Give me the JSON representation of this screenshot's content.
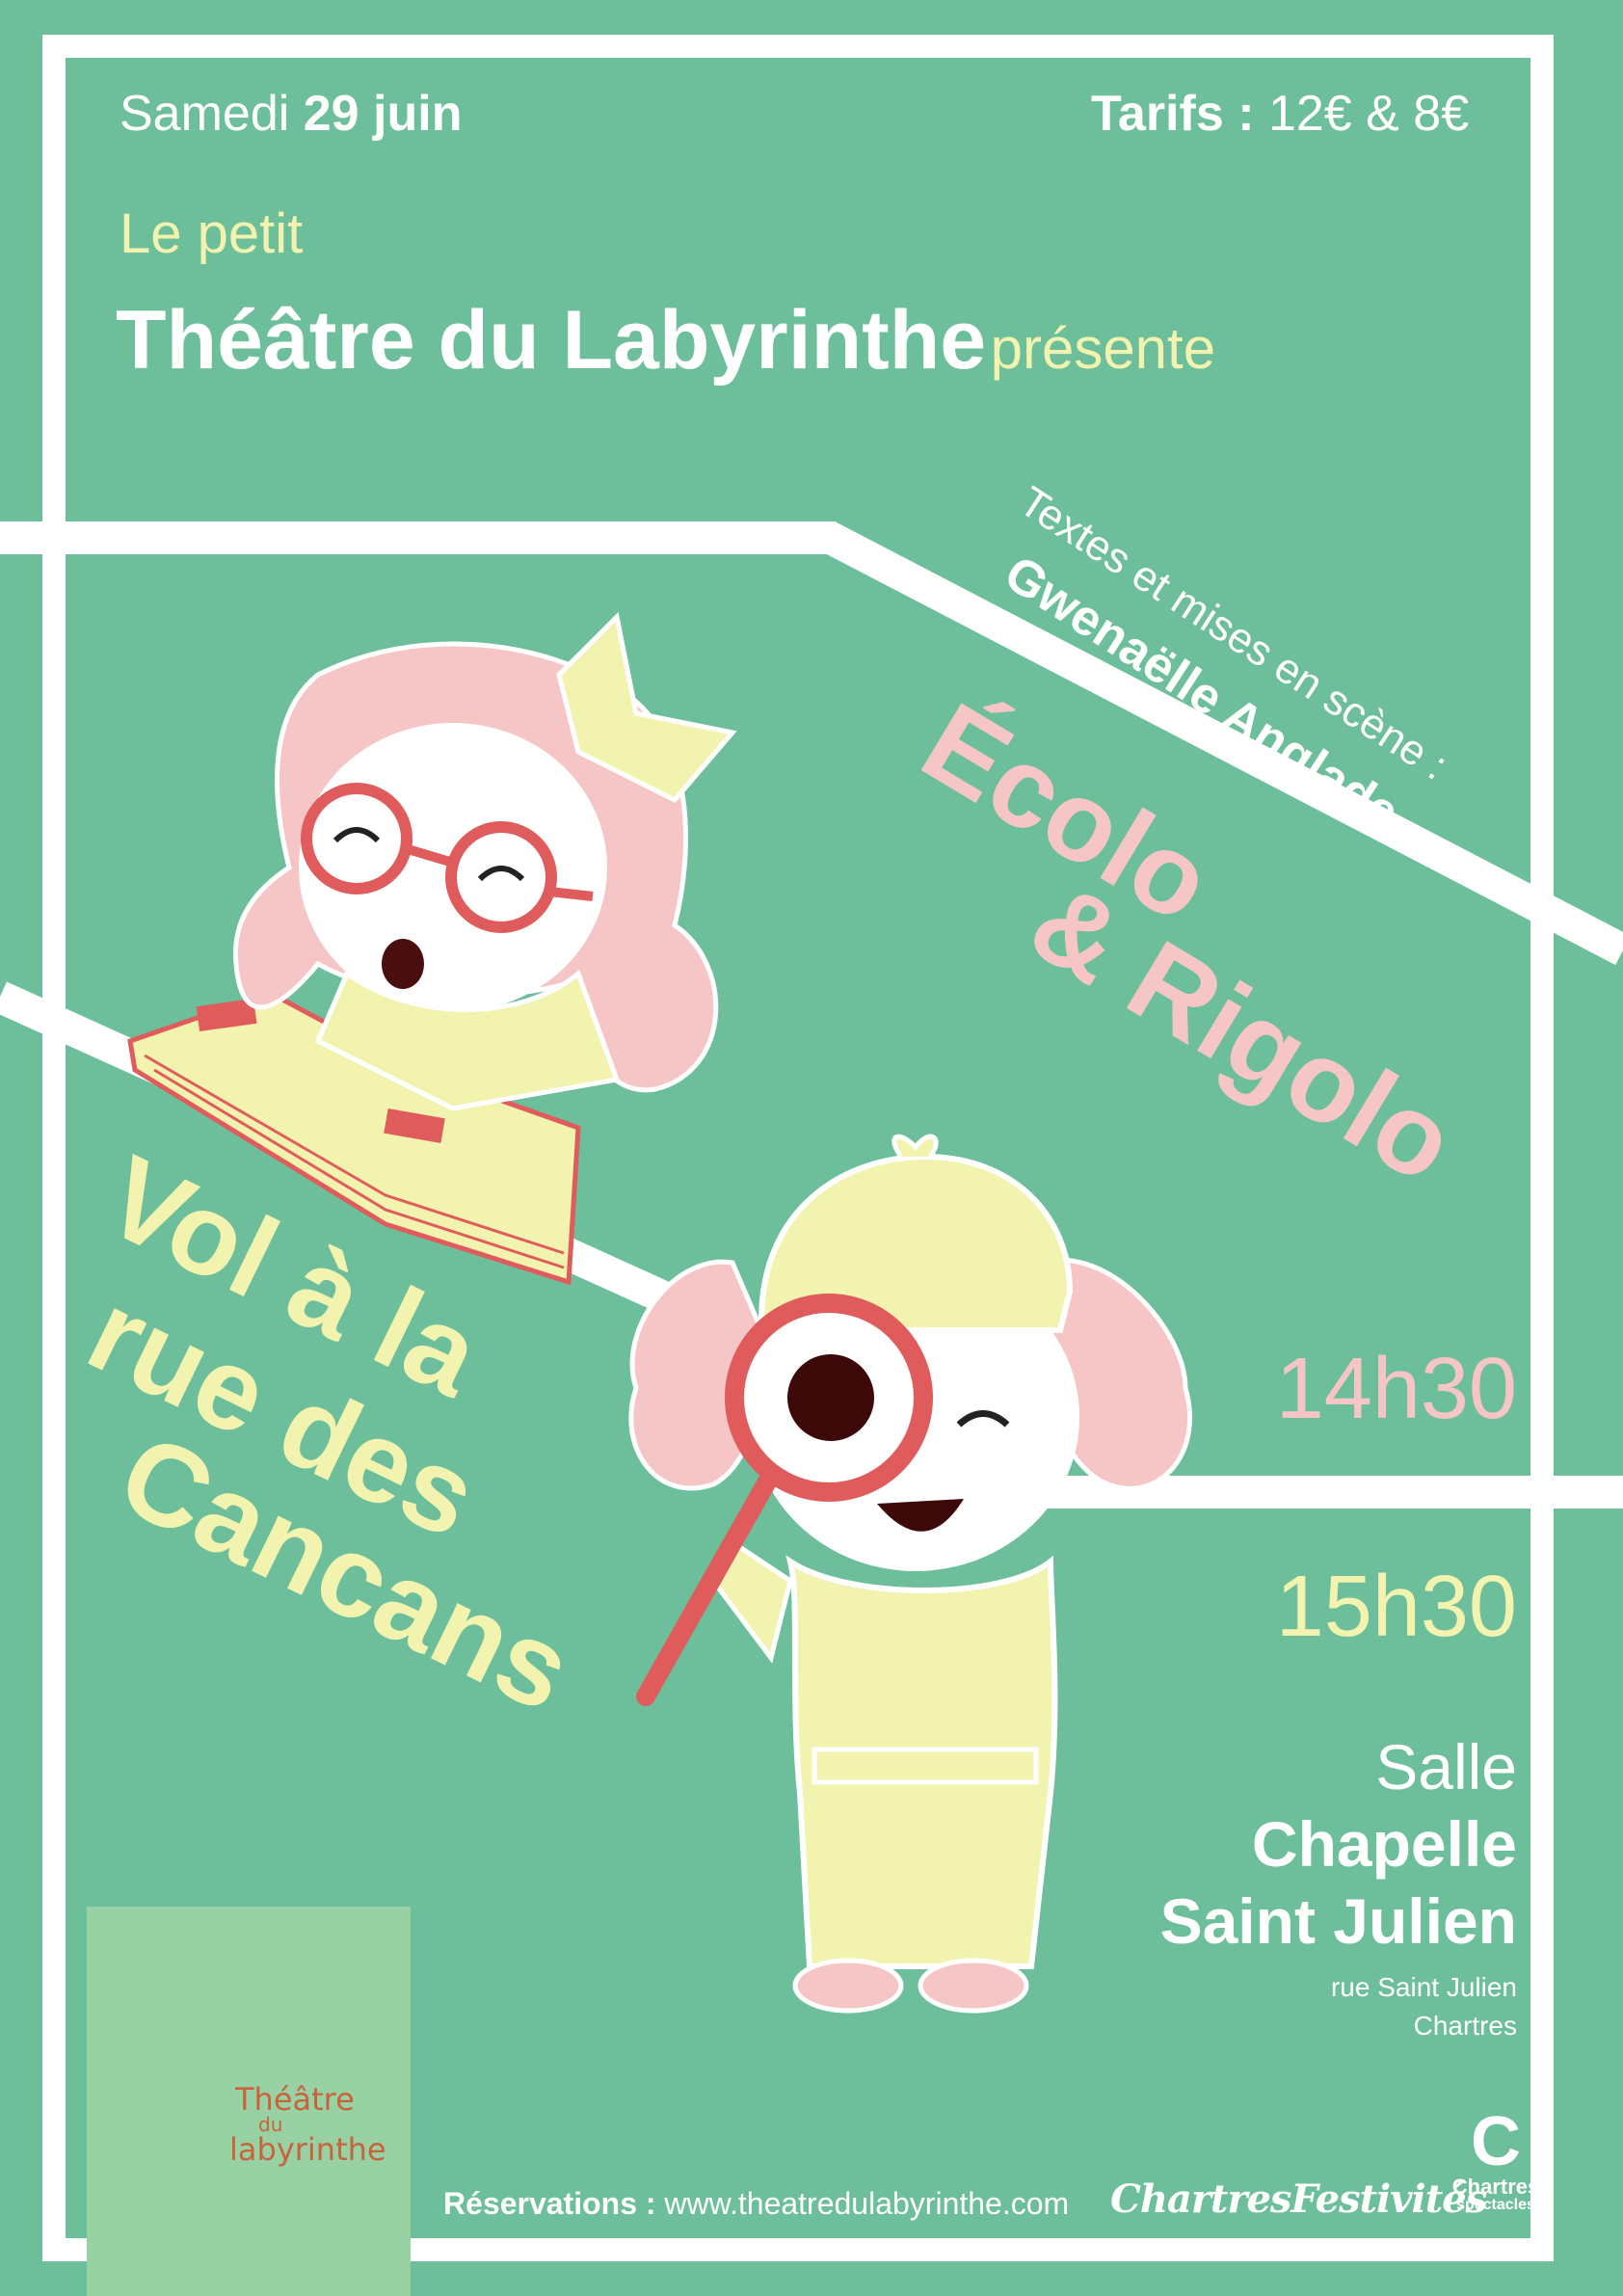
{
  "header": {
    "date_prefix": "Samedi",
    "date_bold": "29 juin",
    "tarifs_label": "Tarifs :",
    "tarifs_value": "12€ & 8€"
  },
  "presenter": {
    "line1": "Le petit",
    "name": "Théâtre du Labyrinthe",
    "suffix": "présente"
  },
  "credits": {
    "line1": "Textes et mises en scène :",
    "line2": "Gwenaëlle Anglade"
  },
  "show1": {
    "line1": "Écolo",
    "line2": "& Rigolo",
    "time": "14h30"
  },
  "show2": {
    "line1": "Vol à la",
    "line2": "rue des",
    "line3": "Cancans",
    "time": "15h30"
  },
  "venue": {
    "salle": "Salle",
    "name1": "Chapelle",
    "name2": "Saint Julien",
    "street": "rue Saint Julien",
    "city": "Chartres"
  },
  "footer": {
    "reservations_label": "Réservations :",
    "reservations_url": "www.theatredulabyrinthe.com",
    "logo_theatre_line1": "Théâtre",
    "logo_theatre_line2": "du",
    "logo_theatre_line3": "labyrinthe",
    "sponsor1": "ChartresFestivités",
    "sponsor2_line1": "Chartres",
    "sponsor2_line2": "spectacles"
  },
  "colors": {
    "background": "#6dbf9c",
    "white": "#ffffff",
    "yellow": "#f3f3b0",
    "pink": "#f6c6c6",
    "red": "#e05c5c",
    "logo_box": "#98d1a4",
    "logo_rust": "#c8643c"
  }
}
